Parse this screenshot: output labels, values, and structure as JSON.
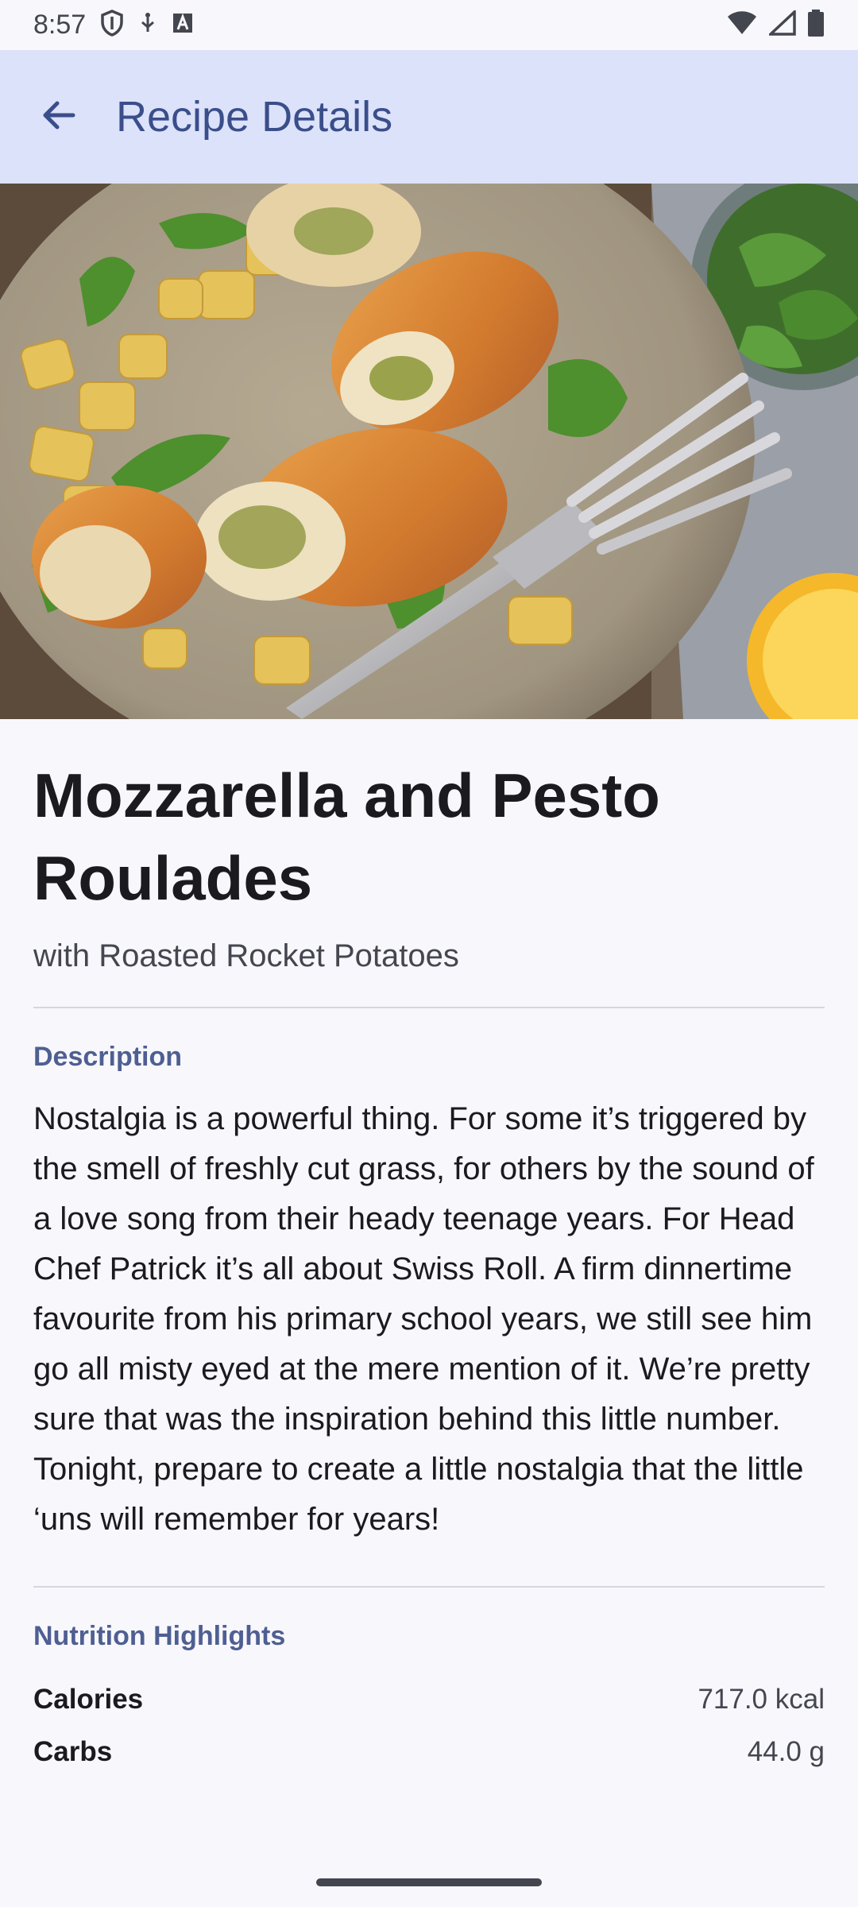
{
  "status_bar": {
    "time": "8:57",
    "icons_left": [
      "shield-icon",
      "usb-icon",
      "font-icon"
    ],
    "icons_right": [
      "wifi-icon",
      "signal-icon",
      "battery-icon"
    ]
  },
  "app_bar": {
    "title": "Recipe Details",
    "back_icon": "arrow-back-icon"
  },
  "recipe": {
    "title": "Mozzarella and Pesto Roulades",
    "subtitle": "with Roasted Rocket Potatoes",
    "description_heading": "Description",
    "description": "Nostalgia is a powerful thing. For some it’s triggered by the smell of freshly cut grass, for others by the sound of a love song from their heady teenage years. For Head Chef Patrick it’s all about Swiss Roll. A firm dinnertime favourite from his primary school years, we still see him go all misty eyed at the mere mention of it. We’re pretty sure that was the inspiration behind this little number. Tonight, prepare to create a little nostalgia that the little ‘uns will remember for years!",
    "nutrition_heading": "Nutrition Highlights",
    "nutrition": [
      {
        "name": "Calories",
        "value": "717.0 kcal"
      },
      {
        "name": "Carbs",
        "value": "44.0 g"
      }
    ]
  },
  "colors": {
    "app_bar_bg": "#dce2fa",
    "accent": "#3a4e8a",
    "section_heading": "#4e5f92",
    "background": "#f8f7fc"
  }
}
